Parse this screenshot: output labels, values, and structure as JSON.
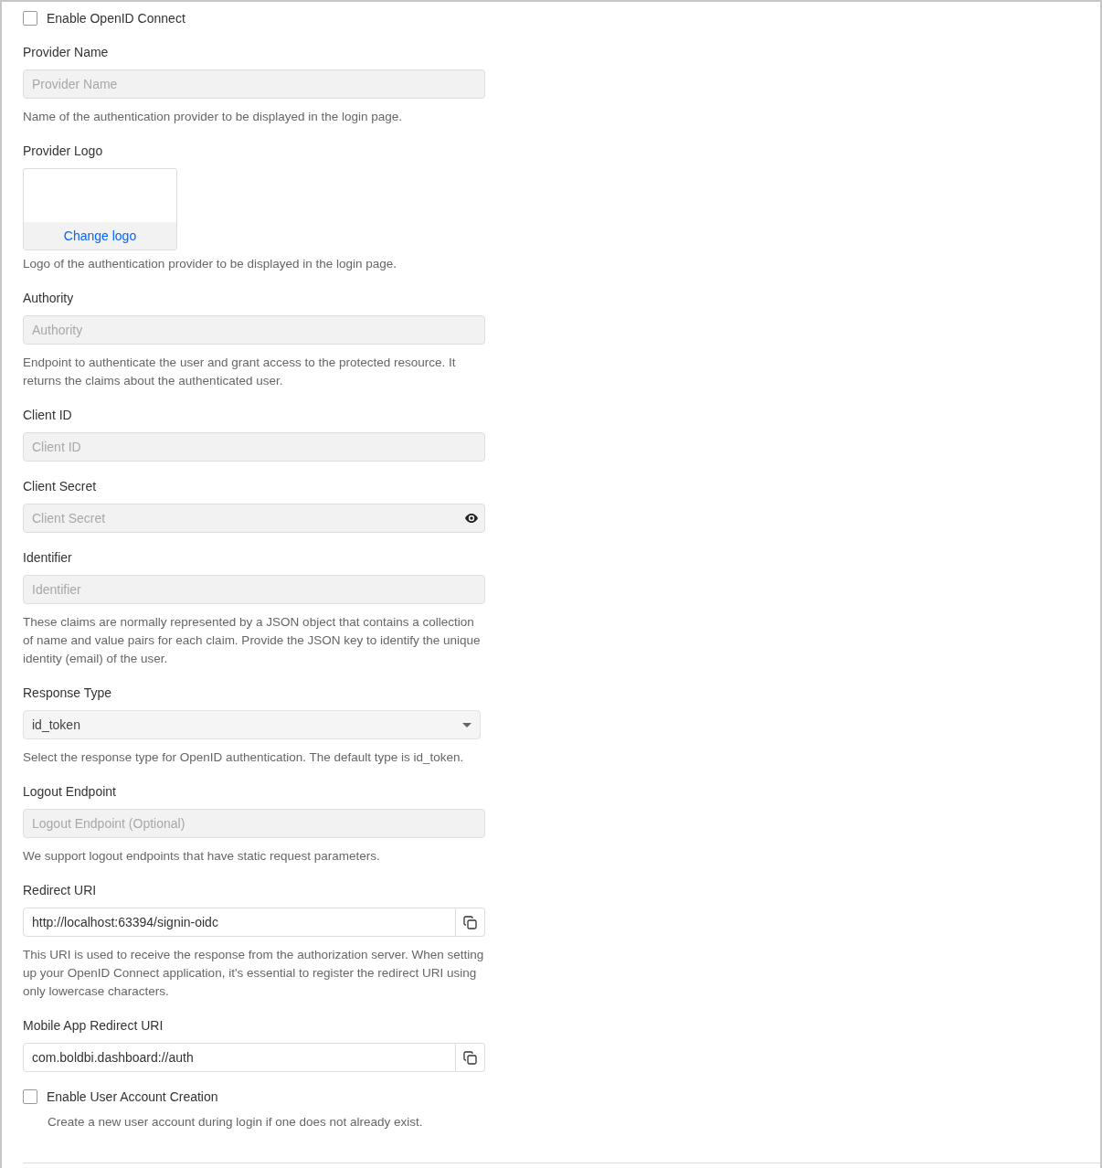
{
  "items": [
    {
      "kind": "checkbox",
      "label": "Enable OpenID Connect",
      "checked": false
    },
    {
      "kind": "text",
      "label": "Provider Name",
      "placeholder": "Provider Name",
      "disabled": true,
      "help": "Name of the authentication provider to be displayed in the login page."
    },
    {
      "kind": "logo",
      "label": "Provider Logo",
      "action": "Change logo",
      "help": "Logo of the authentication provider to be displayed in the login page."
    },
    {
      "kind": "text",
      "label": "Authority",
      "placeholder": "Authority",
      "disabled": true,
      "help": "Endpoint to authenticate the user and grant access to the protected resource. It returns the claims about the authenticated user."
    },
    {
      "kind": "text",
      "label": "Client ID",
      "placeholder": "Client ID",
      "disabled": true
    },
    {
      "kind": "password",
      "label": "Client Secret",
      "placeholder": "Client Secret",
      "disabled": true
    },
    {
      "kind": "text",
      "label": "Identifier",
      "placeholder": "Identifier",
      "disabled": true,
      "help": "These claims are normally represented by a JSON object that contains a collection of name and value pairs for each claim. Provide the JSON key to identify the unique identity (email) of the user."
    },
    {
      "kind": "select",
      "label": "Response Type",
      "value": "id_token",
      "help": "Select the response type for OpenID authentication. The default type is id_token."
    },
    {
      "kind": "text",
      "label": "Logout Endpoint",
      "placeholder": "Logout Endpoint (Optional)",
      "disabled": true,
      "help": "We support logout endpoints that have static request parameters."
    },
    {
      "kind": "copy",
      "label": "Redirect URI",
      "value": "http://localhost:63394/signin-oidc",
      "help": "This URI is used to receive the response from the authorization server. When setting up your OpenID Connect application, it's essential to register the redirect URI using only lowercase characters."
    },
    {
      "kind": "copy",
      "label": "Mobile App Redirect URI",
      "value": "com.boldbi.dashboard://auth"
    },
    {
      "kind": "checkbox",
      "label": "Enable User Account Creation",
      "checked": false,
      "help": "Create a new user account during login if one does not already exist."
    }
  ]
}
